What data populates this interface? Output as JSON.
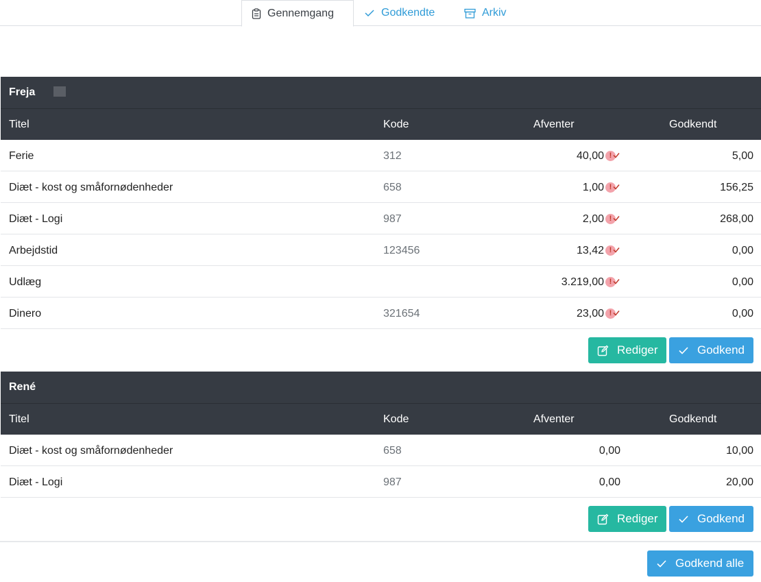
{
  "tabs": [
    {
      "label": "Gennemgang",
      "icon": "clipboard-icon",
      "active": true
    },
    {
      "label": "Godkendte",
      "icon": "check-icon",
      "active": false
    },
    {
      "label": "Arkiv",
      "icon": "archive-icon",
      "active": false
    }
  ],
  "columns": {
    "title": "Titel",
    "code": "Kode",
    "pending": "Afventer",
    "approved": "Godkendt"
  },
  "sections": [
    {
      "name": "Freja",
      "rows": [
        {
          "title": "Ferie",
          "code": "312",
          "pending": "40,00",
          "approved": "5,00",
          "warning": true
        },
        {
          "title": "Diæt - kost og småfornødenheder",
          "code": "658",
          "pending": "1,00",
          "approved": "156,25",
          "warning": true
        },
        {
          "title": "Diæt - Logi",
          "code": "987",
          "pending": "2,00",
          "approved": "268,00",
          "warning": true
        },
        {
          "title": "Arbejdstid",
          "code": "123456",
          "pending": "13,42",
          "approved": "0,00",
          "warning": true
        },
        {
          "title": "Udlæg",
          "code": "",
          "pending": "3.219,00",
          "approved": "0,00",
          "warning": true
        },
        {
          "title": "Dinero",
          "code": "321654",
          "pending": "23,00",
          "approved": "0,00",
          "warning": true
        }
      ],
      "edit_label": "Rediger",
      "approve_label": "Godkend"
    },
    {
      "name": "René",
      "rows": [
        {
          "title": "Diæt - kost og småfornødenheder",
          "code": "658",
          "pending": "0,00",
          "approved": "10,00",
          "warning": false
        },
        {
          "title": "Diæt - Logi",
          "code": "987",
          "pending": "0,00",
          "approved": "20,00",
          "warning": false
        }
      ],
      "edit_label": "Rediger",
      "approve_label": "Godkend"
    }
  ],
  "approve_all_label": "Godkend alle",
  "colors": {
    "header_bg": "#363b43",
    "edit_btn": "#26b8a1",
    "approve_btn": "#3aa1e0",
    "link": "#2f9bd7",
    "warning": "#f3a3ab"
  }
}
